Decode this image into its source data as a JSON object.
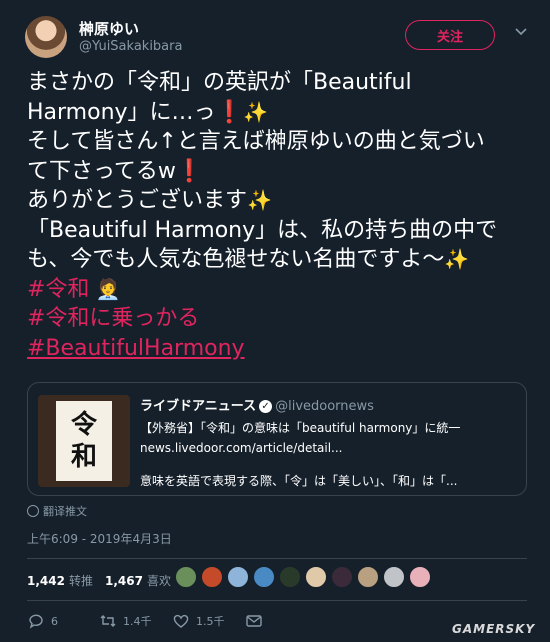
{
  "user": {
    "name": "榊原ゆい",
    "handle": "@YuiSakakibara",
    "follow_label": "关注"
  },
  "tweet": {
    "l1": "まさかの「令和」の英訳が「Beautiful",
    "l2": "Harmony」に…っ",
    "l3": "そして皆さん↑と言えば榊原ゆいの曲と気づい",
    "l4": "て下さってるw",
    "l5": "ありがとうございます",
    "l6": "「Beautiful Harmony」は、私の持ち曲の中で",
    "l7": "も、今でも人気な色褪せない名曲ですよ〜",
    "h1": "#令和",
    "h2": "#令和に乗っかる",
    "h3": "#BeautifulHarmony"
  },
  "card": {
    "thumb_line1": "令",
    "thumb_line2": "和",
    "source": "ライブドアニュース",
    "source_handle": "@livedoornews",
    "headline": "【外務省】「令和」の意味は「beautiful harmony」に統一",
    "url": "news.livedoor.com/article/detail...",
    "snippet": "意味を英語で表現する際、「令」は「美しい」、「和」は「..."
  },
  "translate_label": "翻译推文",
  "timestamp": "上午6:09 - 2019年4月3日",
  "stats": {
    "retweets": "1,442",
    "retweets_label": "转推",
    "likes": "1,467",
    "likes_label": "喜欢"
  },
  "liker_avatar_colors": [
    "#6a8f5a",
    "#c44a2a",
    "#8fb4d9",
    "#4a8ac4",
    "#2a3a2a",
    "#e0c9a8",
    "#3a2a3a",
    "#b8a080",
    "#c0c4c8",
    "#e8b0b8"
  ],
  "actions": {
    "replies": "6",
    "retweets": "1.4千",
    "likes": "1.5千"
  },
  "watermark": "GAMERSKY",
  "colors": {
    "background": "#15202b",
    "accent": "#e0245e",
    "muted": "#8899a6"
  }
}
